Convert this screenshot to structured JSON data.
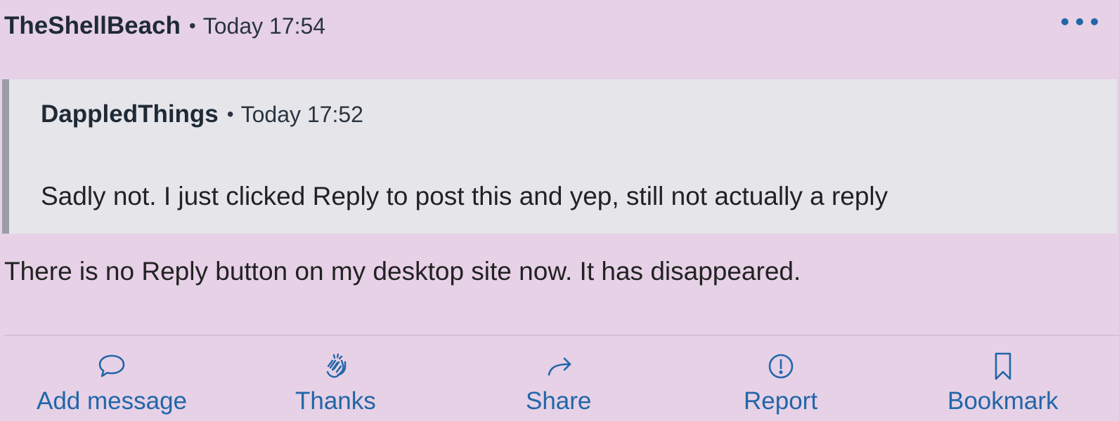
{
  "post": {
    "author": "TheShellBeach",
    "separator": "•",
    "time": "Today 17:54",
    "body": "There is no Reply button on my desktop site now. It has disappeared."
  },
  "quote": {
    "author": "DappledThings",
    "separator": "•",
    "time": "Today 17:52",
    "text": "Sadly not. I just clicked Reply to post this and yep, still not actually a reply"
  },
  "actions": {
    "add_message": {
      "label": "Add message",
      "icon": "speech-bubble-icon"
    },
    "thanks": {
      "label": "Thanks",
      "icon": "clapping-hands-icon"
    },
    "share": {
      "label": "Share",
      "icon": "share-arrow-icon"
    },
    "report": {
      "label": "Report",
      "icon": "exclamation-circle-icon"
    },
    "bookmark": {
      "label": "Bookmark",
      "icon": "bookmark-icon"
    }
  },
  "more_menu": {
    "icon": "ellipsis-icon"
  },
  "colors": {
    "background": "#e6d1e6",
    "quote_background": "#e6e6ea",
    "quote_border": "#9a9ea8",
    "accent": "#2166a8",
    "text": "#222222"
  }
}
